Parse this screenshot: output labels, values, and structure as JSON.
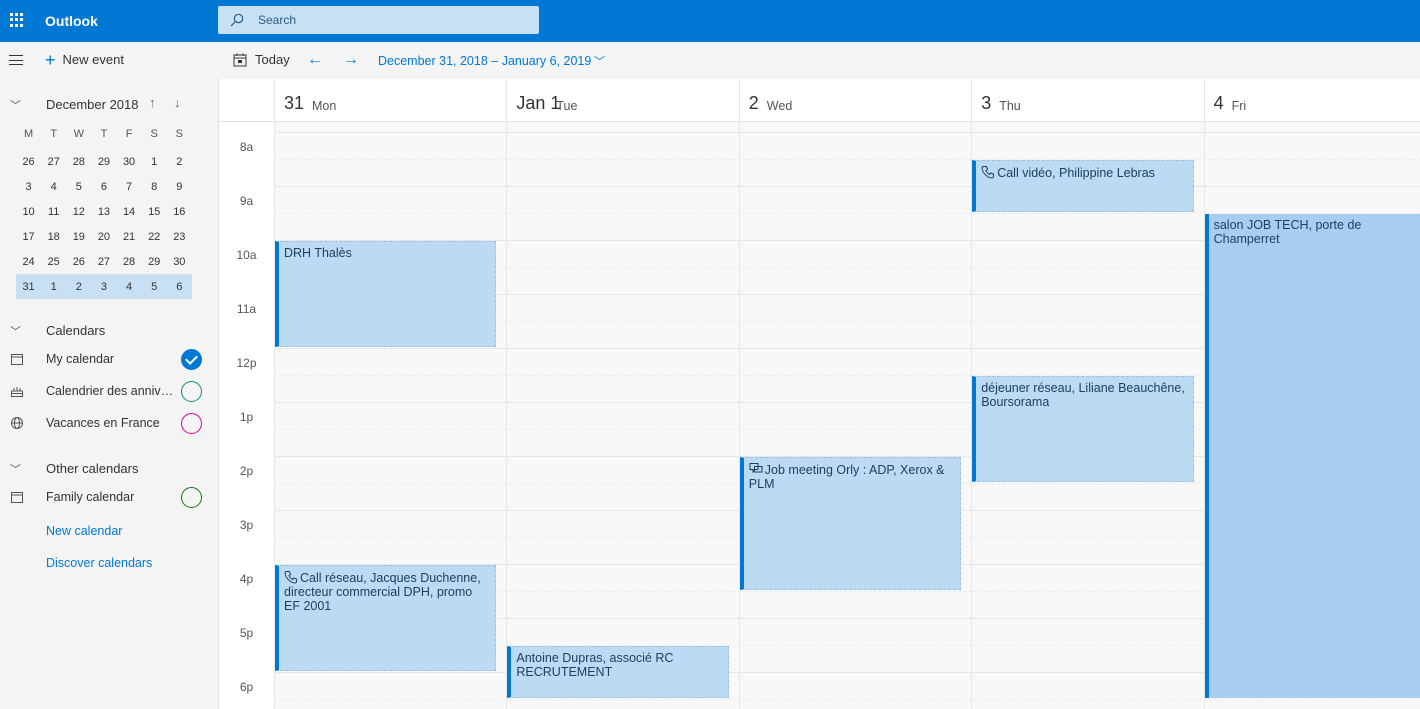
{
  "app": {
    "title": "Outlook"
  },
  "search": {
    "placeholder": "Search"
  },
  "commands": {
    "new_event": "New event",
    "today": "Today",
    "date_range": "December 31, 2018 – January 6, 2019"
  },
  "mini_calendar": {
    "month": "December 2018",
    "weekdays": [
      "M",
      "T",
      "W",
      "T",
      "F",
      "S",
      "S"
    ],
    "weeks": [
      [
        "26",
        "27",
        "28",
        "29",
        "30",
        "1",
        "2"
      ],
      [
        "3",
        "4",
        "5",
        "6",
        "7",
        "8",
        "9"
      ],
      [
        "10",
        "11",
        "12",
        "13",
        "14",
        "15",
        "16"
      ],
      [
        "17",
        "18",
        "19",
        "20",
        "21",
        "22",
        "23"
      ],
      [
        "24",
        "25",
        "26",
        "27",
        "28",
        "29",
        "30"
      ],
      [
        "31",
        "1",
        "2",
        "3",
        "4",
        "5",
        "6"
      ]
    ],
    "selected_week": 5
  },
  "calendars": {
    "header": "Calendars",
    "items": [
      {
        "label": "My calendar",
        "color": "#0078d4",
        "checked": true,
        "icon": "calendar-icon"
      },
      {
        "label": "Calendrier des anniversaires",
        "color": "#0a8a8a",
        "checked": false,
        "icon": "birthday-cake-icon"
      },
      {
        "label": "Vacances en France",
        "color": "#e3008c",
        "checked": false,
        "icon": "globe-icon"
      }
    ]
  },
  "other_calendars": {
    "header": "Other calendars",
    "items": [
      {
        "label": "Family calendar",
        "color": "#107c10",
        "checked": false,
        "icon": "calendar-icon"
      }
    ],
    "new_calendar": "New calendar",
    "discover": "Discover calendars"
  },
  "days": [
    {
      "num": "31",
      "name": "Mon"
    },
    {
      "num": "Jan 1",
      "name": "Tue"
    },
    {
      "num": "2",
      "name": "Wed"
    },
    {
      "num": "3",
      "name": "Thu"
    },
    {
      "num": "4",
      "name": "Fri"
    }
  ],
  "hours": [
    "8a",
    "9a",
    "10a",
    "11a",
    "12p",
    "1p",
    "2p",
    "3p",
    "4p",
    "5p",
    "6p"
  ],
  "events": [
    {
      "day": 0,
      "start": 10.0,
      "end": 12.0,
      "title": "DRH Thalès",
      "icon": ""
    },
    {
      "day": 0,
      "start": 16.0,
      "end": 18.0,
      "title": "Call réseau, Jacques Duchenne, directeur commercial DPH, promo EF 2001",
      "icon": "phone"
    },
    {
      "day": 1,
      "start": 17.5,
      "end": 18.5,
      "title": "Antoine Dupras, associé RC RECRUTEMENT",
      "icon": ""
    },
    {
      "day": 2,
      "start": 14.0,
      "end": 16.5,
      "title": "Job meeting Orly : ADP, Xerox & PLM",
      "icon": "chat"
    },
    {
      "day": 3,
      "start": 8.5,
      "end": 9.5,
      "title": "Call vidéo, Philippine Lebras",
      "icon": "phone"
    },
    {
      "day": 3,
      "start": 12.5,
      "end": 14.5,
      "title": "déjeuner réseau, Liliane Beauchêne, Boursorama",
      "icon": ""
    },
    {
      "day": 4,
      "start": 9.5,
      "end": 18.5,
      "title": "salon JOB TECH, porte de Champerret",
      "icon": ""
    }
  ]
}
